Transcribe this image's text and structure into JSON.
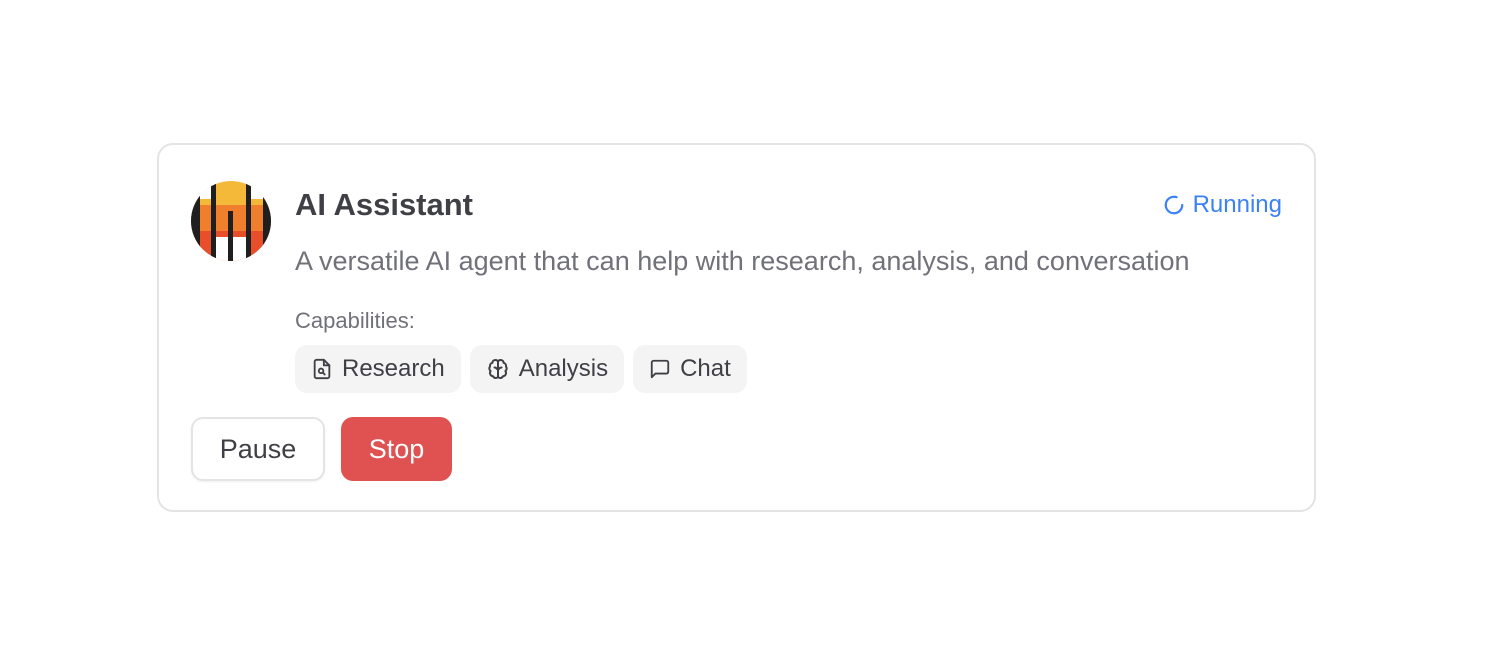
{
  "agent": {
    "name": "AI Assistant",
    "description": "A versatile AI agent that can help with research, analysis, and conversation",
    "avatar_icon": "stacked-stripes-logo",
    "status": {
      "label": "Running",
      "icon": "loading-spinner-icon",
      "color": "#3b82f6"
    }
  },
  "capabilities": {
    "label": "Capabilities:",
    "items": [
      {
        "label": "Research",
        "icon": "file-search-icon"
      },
      {
        "label": "Analysis",
        "icon": "brain-icon"
      },
      {
        "label": "Chat",
        "icon": "message-square-icon"
      }
    ]
  },
  "actions": {
    "pause_label": "Pause",
    "stop_label": "Stop",
    "stop_color": "#e05252"
  }
}
